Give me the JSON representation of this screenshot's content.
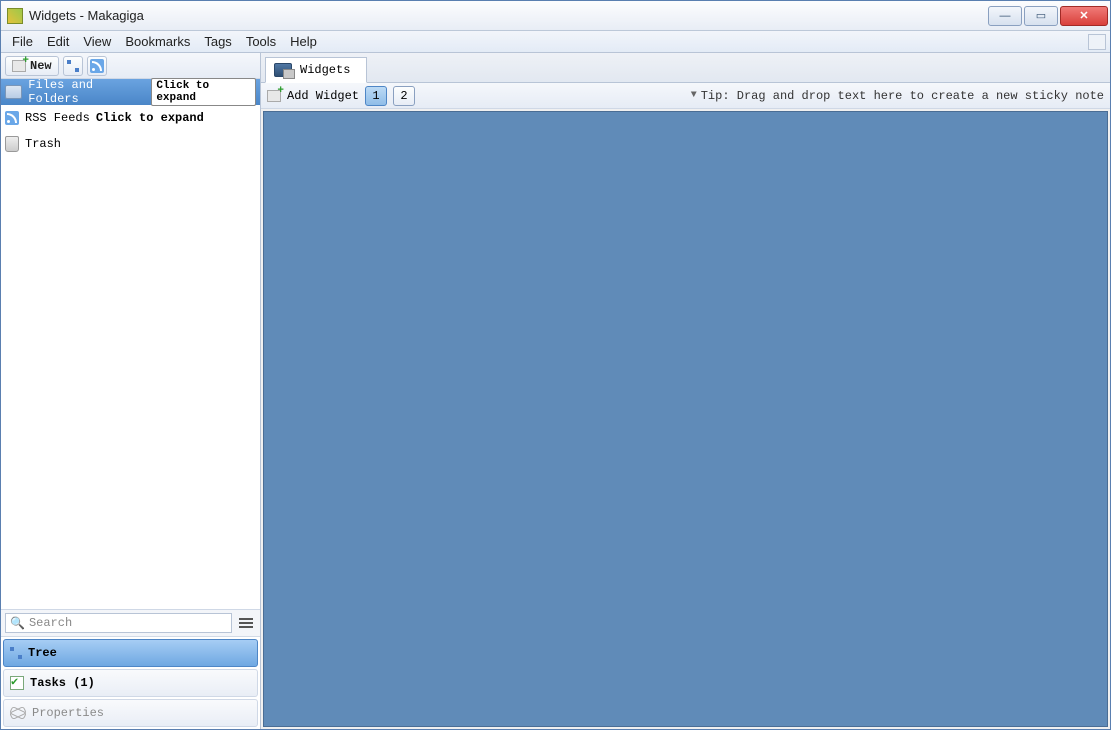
{
  "window": {
    "title": "Widgets - Makagiga"
  },
  "menu": {
    "file": "File",
    "edit": "Edit",
    "view": "View",
    "bookmarks": "Bookmarks",
    "tags": "Tags",
    "tools": "Tools",
    "help": "Help"
  },
  "sidebar": {
    "toolbar": {
      "new_label": "New"
    },
    "tree": {
      "files_label": "Files and Folders",
      "files_hint": "Click to expand",
      "rss_label": "RSS Feeds",
      "rss_hint": "Click to expand",
      "trash_label": "Trash"
    },
    "search_placeholder": "Search",
    "tabs": {
      "tree": "Tree",
      "tasks": "Tasks (1)",
      "properties": "Properties"
    }
  },
  "main": {
    "tab_label": "Widgets",
    "add_widget_label": "Add Widget",
    "page1": "1",
    "page2": "2",
    "tip": "Tip: Drag and drop text here to create a new sticky note"
  }
}
